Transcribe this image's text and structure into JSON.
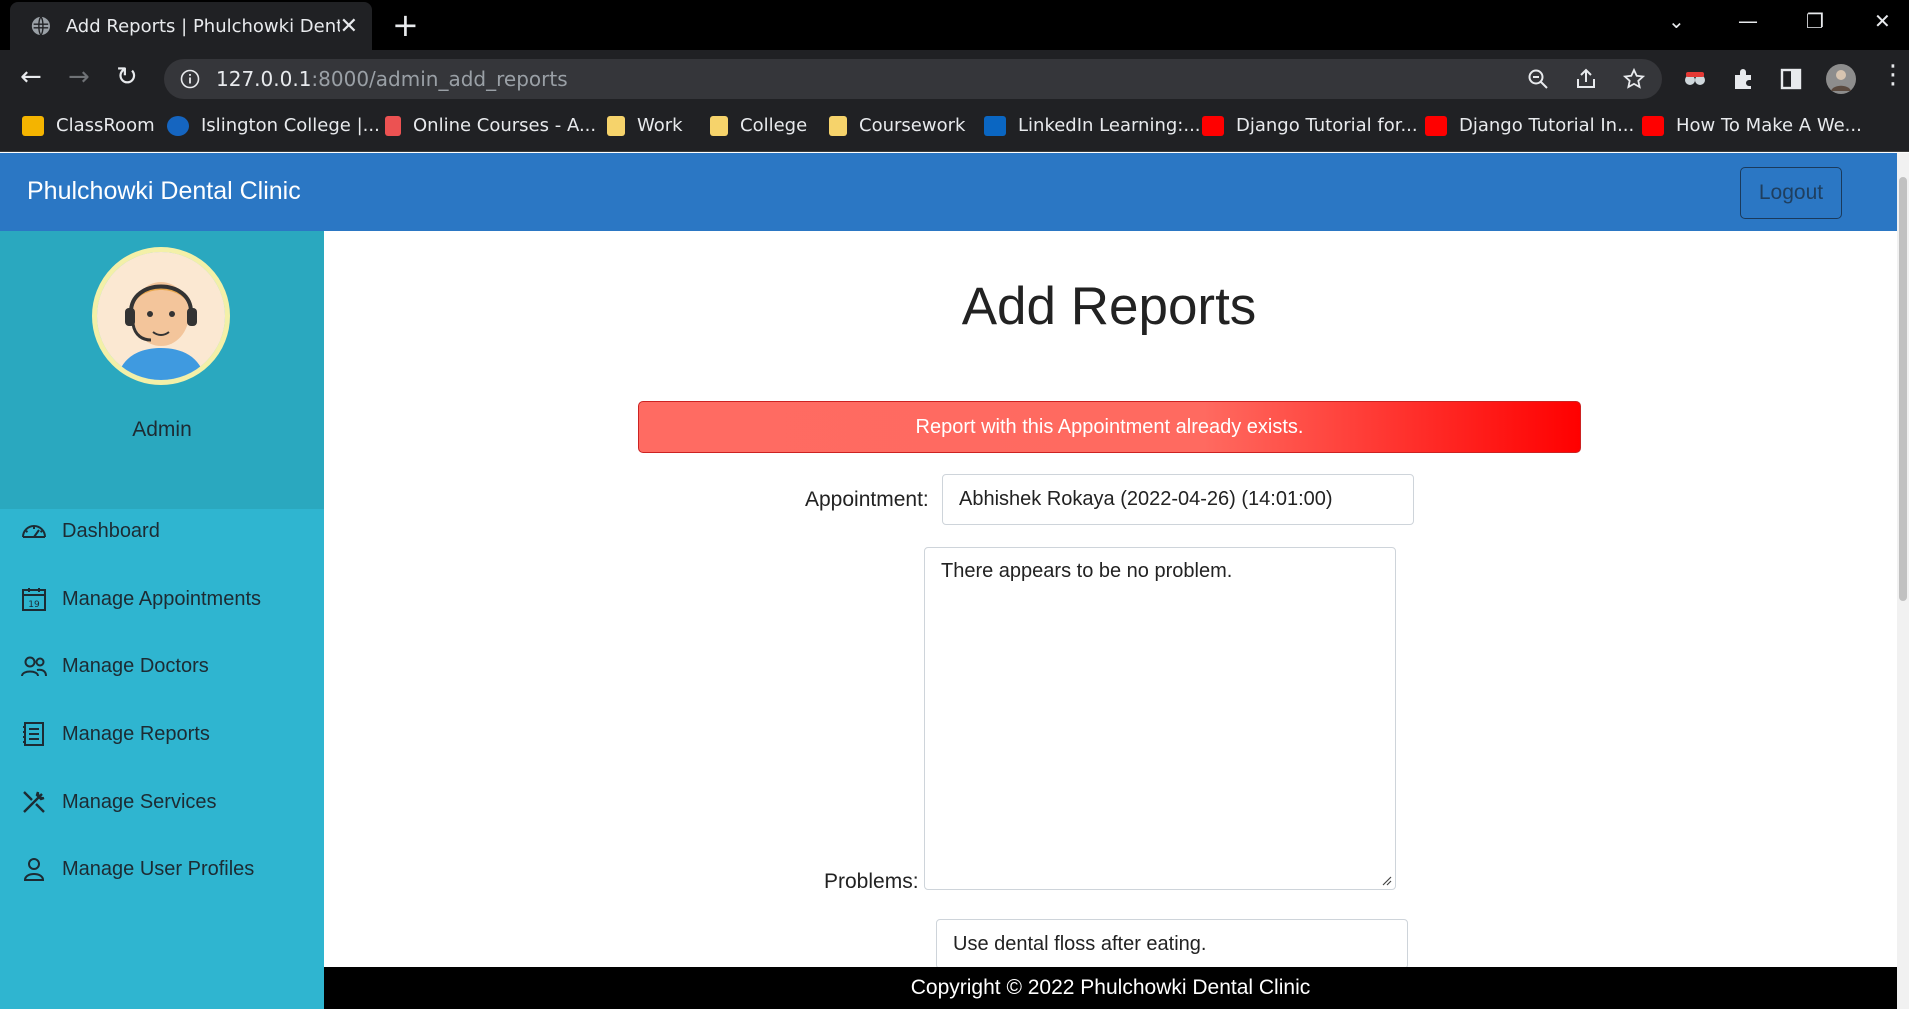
{
  "browser": {
    "tab_title": "Add Reports | Phulchowki Dental",
    "tab_close": "✕",
    "new_tab": "+",
    "url_host": "127.0.0.1",
    "url_rest": ":8000/admin_add_reports",
    "bookmarks": [
      {
        "label": "ClassRoom",
        "icon": "classroom-icon",
        "color": "#f4b400"
      },
      {
        "label": "Islington College |...",
        "icon": "islington-icon",
        "color": "#1565c0"
      },
      {
        "label": "Online Courses - A...",
        "icon": "udemy-icon",
        "color": "#ec5252"
      },
      {
        "label": "Work",
        "icon": "folder-icon",
        "color": "#f6d36b"
      },
      {
        "label": "College",
        "icon": "folder-icon",
        "color": "#f6d36b"
      },
      {
        "label": "Coursework",
        "icon": "folder-icon",
        "color": "#f6d36b"
      },
      {
        "label": "LinkedIn Learning:...",
        "icon": "linkedin-learning-icon",
        "color": "#0a66c2"
      },
      {
        "label": "Django Tutorial for...",
        "icon": "youtube-icon",
        "color": "#ff0000"
      },
      {
        "label": "Django Tutorial In...",
        "icon": "youtube-icon",
        "color": "#ff0000"
      },
      {
        "label": "How To Make A We...",
        "icon": "youtube-icon",
        "color": "#ff0000"
      }
    ]
  },
  "header": {
    "brand": "Phulchowki Dental Clinic",
    "logout_label": "Logout",
    "color": "#2b77c4"
  },
  "sidebar": {
    "user_name": "Admin",
    "items": [
      {
        "label": "Dashboard",
        "icon": "dashboard-icon"
      },
      {
        "label": "Manage Appointments",
        "icon": "calendar-icon"
      },
      {
        "label": "Manage Doctors",
        "icon": "users-icon"
      },
      {
        "label": "Manage Reports",
        "icon": "report-icon"
      },
      {
        "label": "Manage Services",
        "icon": "tools-icon"
      },
      {
        "label": "Manage User Profiles",
        "icon": "user-icon"
      }
    ]
  },
  "main": {
    "title": "Add Reports",
    "alert": "Report with this Appointment already exists.",
    "appointment_label": "Appointment:",
    "appointment_value": "Abhishek Rokaya (2022-04-26) (14:01:00)",
    "problems_label": "Problems:",
    "problems_value": "There appears to be no problem.",
    "advice_value": "Use dental floss after eating."
  },
  "footer": {
    "text": "Copyright © 2022 Phulchowki Dental Clinic"
  }
}
